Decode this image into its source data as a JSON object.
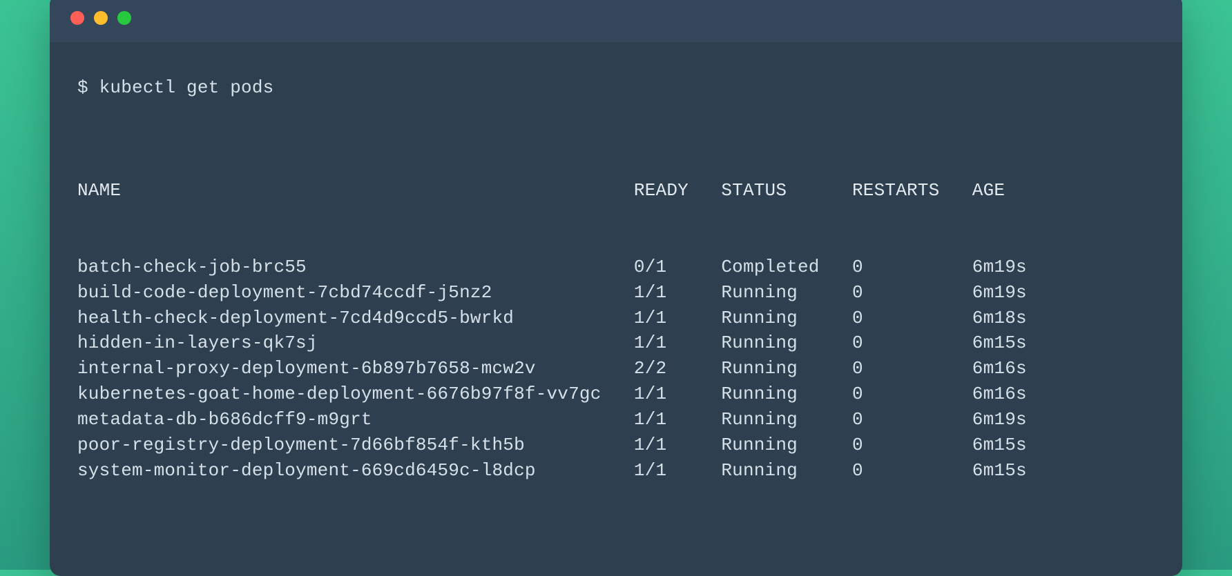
{
  "prompt": "$ ",
  "command": "kubectl get pods",
  "columns": {
    "name": "NAME",
    "ready": "READY",
    "status": "STATUS",
    "restarts": "RESTARTS",
    "age": "AGE"
  },
  "rows": [
    {
      "name": "batch-check-job-brc55",
      "ready": "0/1",
      "status": "Completed",
      "restarts": "0",
      "age": "6m19s"
    },
    {
      "name": "build-code-deployment-7cbd74ccdf-j5nz2",
      "ready": "1/1",
      "status": "Running",
      "restarts": "0",
      "age": "6m19s"
    },
    {
      "name": "health-check-deployment-7cd4d9ccd5-bwrkd",
      "ready": "1/1",
      "status": "Running",
      "restarts": "0",
      "age": "6m18s"
    },
    {
      "name": "hidden-in-layers-qk7sj",
      "ready": "1/1",
      "status": "Running",
      "restarts": "0",
      "age": "6m15s"
    },
    {
      "name": "internal-proxy-deployment-6b897b7658-mcw2v",
      "ready": "2/2",
      "status": "Running",
      "restarts": "0",
      "age": "6m16s"
    },
    {
      "name": "kubernetes-goat-home-deployment-6676b97f8f-vv7gc",
      "ready": "1/1",
      "status": "Running",
      "restarts": "0",
      "age": "6m16s"
    },
    {
      "name": "metadata-db-b686dcff9-m9grt",
      "ready": "1/1",
      "status": "Running",
      "restarts": "0",
      "age": "6m19s"
    },
    {
      "name": "poor-registry-deployment-7d66bf854f-kth5b",
      "ready": "1/1",
      "status": "Running",
      "restarts": "0",
      "age": "6m15s"
    },
    {
      "name": "system-monitor-deployment-669cd6459c-l8dcp",
      "ready": "1/1",
      "status": "Running",
      "restarts": "0",
      "age": "6m15s"
    }
  ],
  "layout": {
    "col_name_width": 51,
    "col_ready_width": 8,
    "col_status_width": 12,
    "col_restarts_width": 11
  }
}
